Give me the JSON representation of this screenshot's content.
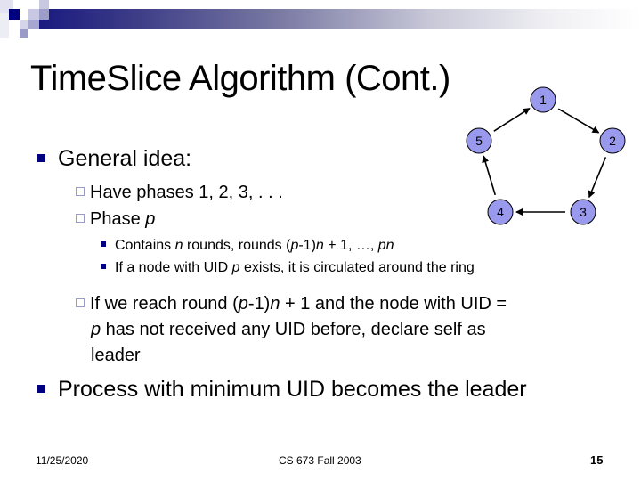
{
  "slide": {
    "title": "TimeSlice Algorithm (Cont.)",
    "bullets": [
      {
        "text": "General idea:",
        "sub": [
          {
            "text": "Have phases 1, 2, 3, . . ."
          },
          {
            "text_plain": "Phase ",
            "text_italic": "p",
            "sub": [
              {
                "parts": [
                  "Contains ",
                  "n",
                  " rounds, rounds (",
                  "p",
                  "-1)",
                  "n",
                  " + 1, …, ",
                  "pn"
                ]
              },
              {
                "parts": [
                  "If a node with UID ",
                  "p",
                  " exists, it is circulated around the ring"
                ]
              }
            ]
          },
          {
            "line1_parts": [
              "If we reach round (",
              "p",
              "-1)",
              "n",
              " + 1 and the node with UID ="
            ],
            "line2_parts": [
              "p",
              " has not received any UID before, declare self as"
            ],
            "line3": "leader"
          }
        ]
      },
      {
        "text": "Process with minimum UID becomes the leader"
      }
    ]
  },
  "ring_diagram": {
    "nodes": [
      "1",
      "2",
      "3",
      "4",
      "5"
    ],
    "edges": [
      [
        "1",
        "2"
      ],
      [
        "2",
        "3"
      ],
      [
        "3",
        "4"
      ],
      [
        "4",
        "5"
      ],
      [
        "5",
        "1"
      ]
    ],
    "node_fill": "#9999ee",
    "node_stroke": "#000000"
  },
  "footer": {
    "date": "11/25/2020",
    "course": "CS 673 Fall 2003",
    "page": "15"
  }
}
